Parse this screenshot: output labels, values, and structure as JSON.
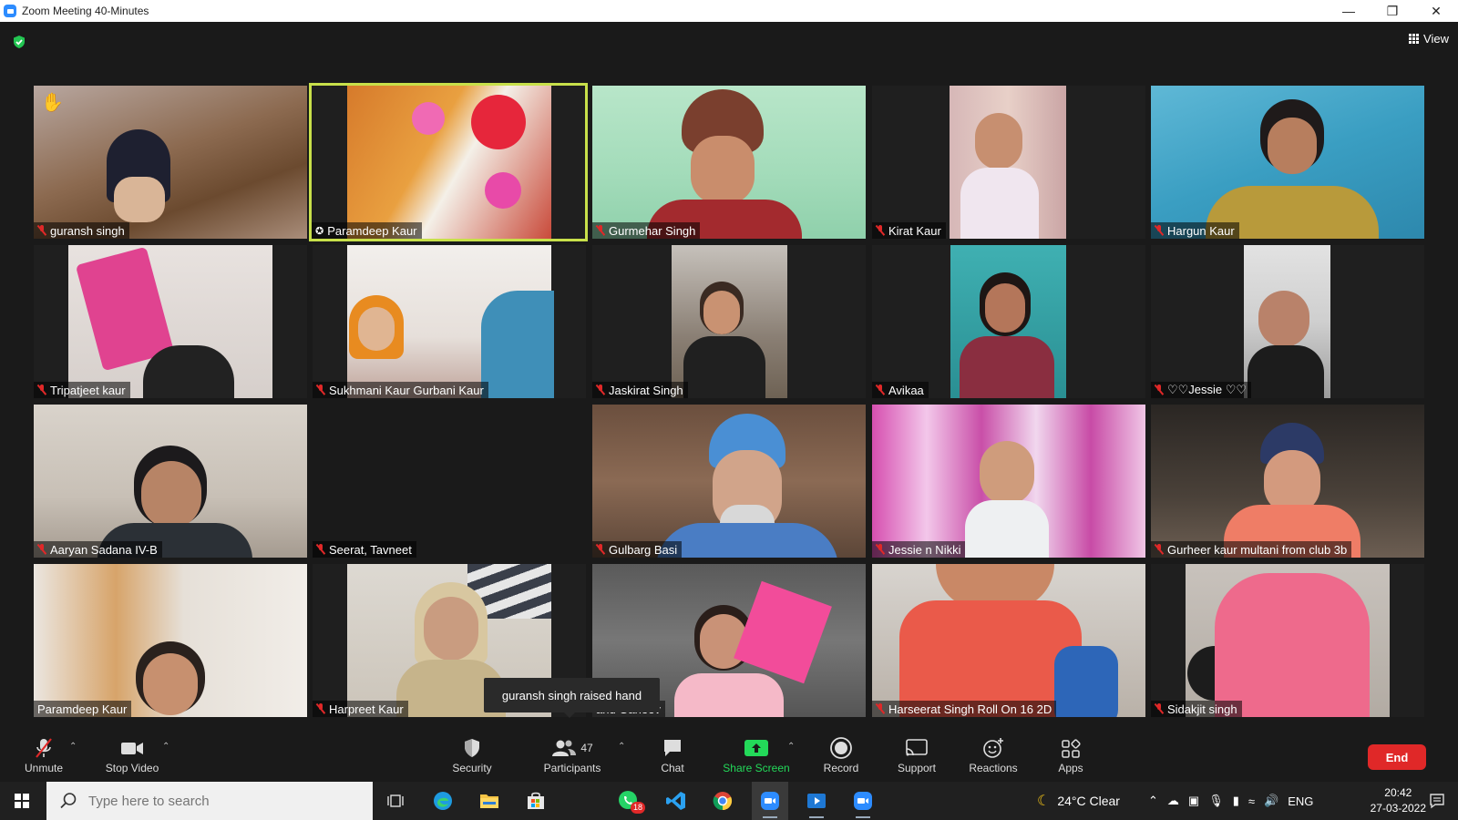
{
  "window": {
    "title": "Zoom Meeting 40-Minutes"
  },
  "view_label": "View",
  "tiles": [
    {
      "name": "guransh singh",
      "hand_raised": true
    },
    {
      "name": "Paramdeep Kaur",
      "pinned": true,
      "active_speaker": true
    },
    {
      "name": "Gurmehar Singh"
    },
    {
      "name": "Kirat Kaur"
    },
    {
      "name": "Hargun Kaur"
    },
    {
      "name": "Tripatjeet kaur"
    },
    {
      "name": "Sukhmani Kaur Gurbani Kaur"
    },
    {
      "name": "Jaskirat Singh"
    },
    {
      "name": "Avikaa"
    },
    {
      "name": "♡♡Jessie ♡♡"
    },
    {
      "name": "Aaryan Sadana IV-B"
    },
    {
      "name": "Seerat, Tavneet"
    },
    {
      "name": "Gulbarg Basi"
    },
    {
      "name": "Jessie n Nikki"
    },
    {
      "name": "Gurheer kaur multani from club 3b"
    },
    {
      "name": "Paramdeep Kaur"
    },
    {
      "name": "Harpreet Kaur"
    },
    {
      "name": "and Ganeev"
    },
    {
      "name": "Harseerat Singh Roll On 16 2D"
    },
    {
      "name": "Sidakjit singh"
    }
  ],
  "tooltip": "guransh singh raised hand",
  "toolbar": {
    "unmute": "Unmute",
    "stop_video": "Stop Video",
    "security": "Security",
    "participants": "Participants",
    "participant_count": "47",
    "chat": "Chat",
    "share_screen": "Share Screen",
    "record": "Record",
    "support": "Support",
    "reactions": "Reactions",
    "apps": "Apps",
    "end": "End"
  },
  "taskbar": {
    "search_placeholder": "Type here to search",
    "whatsapp_badge": "18",
    "weather": "24°C  Clear",
    "language": "ENG",
    "time": "20:42",
    "date": "27-03-2022"
  },
  "colors": {
    "active_border": "#c8e04a",
    "end_button": "#e02828",
    "share_screen": "#23d959",
    "zoom_blue": "#2d8cff"
  }
}
